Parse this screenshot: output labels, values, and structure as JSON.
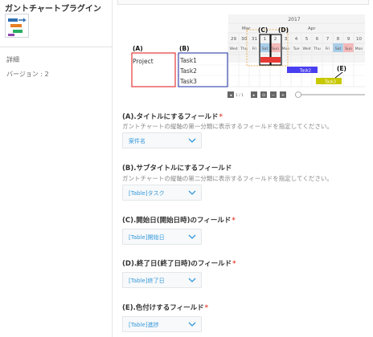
{
  "sidebar": {
    "title": "ガントチャートプラグイン",
    "detail_label": "詳細",
    "version_label": "バージョン : 2"
  },
  "gantt_preview": {
    "year": "2017",
    "months": [
      "Mar",
      "Apr"
    ],
    "dates": [
      "29",
      "30",
      "31",
      "1",
      "2",
      "3",
      "4",
      "5",
      "6",
      "7",
      "8",
      "9",
      "10"
    ],
    "weekdays": [
      "Wed",
      "Thu",
      "Fri",
      "Sat",
      "Sun",
      "Mon",
      "Tue",
      "Wed",
      "Thu",
      "Fri",
      "Sat",
      "Sun",
      "Mon"
    ],
    "title_row": "Project",
    "subtitle_rows": [
      "Task1",
      "Task2",
      "Task3"
    ],
    "bars": [
      "Task2",
      "Task3"
    ],
    "markers": [
      "(A)",
      "(B)",
      "(C)",
      "(D)",
      "(E)"
    ],
    "pager": "1 / 1",
    "colors": {
      "marker_a": "#e53935",
      "marker_b": "#3f51b5",
      "bar_task2": "#4a3ff0",
      "bar_task3": "#c8c800",
      "today": "#e53935"
    }
  },
  "form": {
    "fields": [
      {
        "label": "(A).タイトルにするフィールド",
        "required": true,
        "required_mark": "*",
        "description": "ガントチャートの縦軸の第一分類に表示するフィールドを指定してください。",
        "value": "案件名"
      },
      {
        "label": "(B).サブタイトルにするフィールド",
        "required": false,
        "required_mark": "",
        "description": "ガントチャートの縦軸の第二分類に表示するフィールドを指定してください。",
        "value": "[Table]タスク"
      },
      {
        "label": "(C).開始日(開始日時)のフィールド",
        "required": true,
        "required_mark": "*",
        "description": "",
        "value": "[Table]開始日"
      },
      {
        "label": "(D).終了日(終了日時)のフィールド",
        "required": true,
        "required_mark": "*",
        "description": "",
        "value": "[Table]終了日"
      },
      {
        "label": "(E).色付けするフィールド",
        "required": true,
        "required_mark": "*",
        "description": "",
        "value": "[Table]進捗"
      }
    ]
  }
}
